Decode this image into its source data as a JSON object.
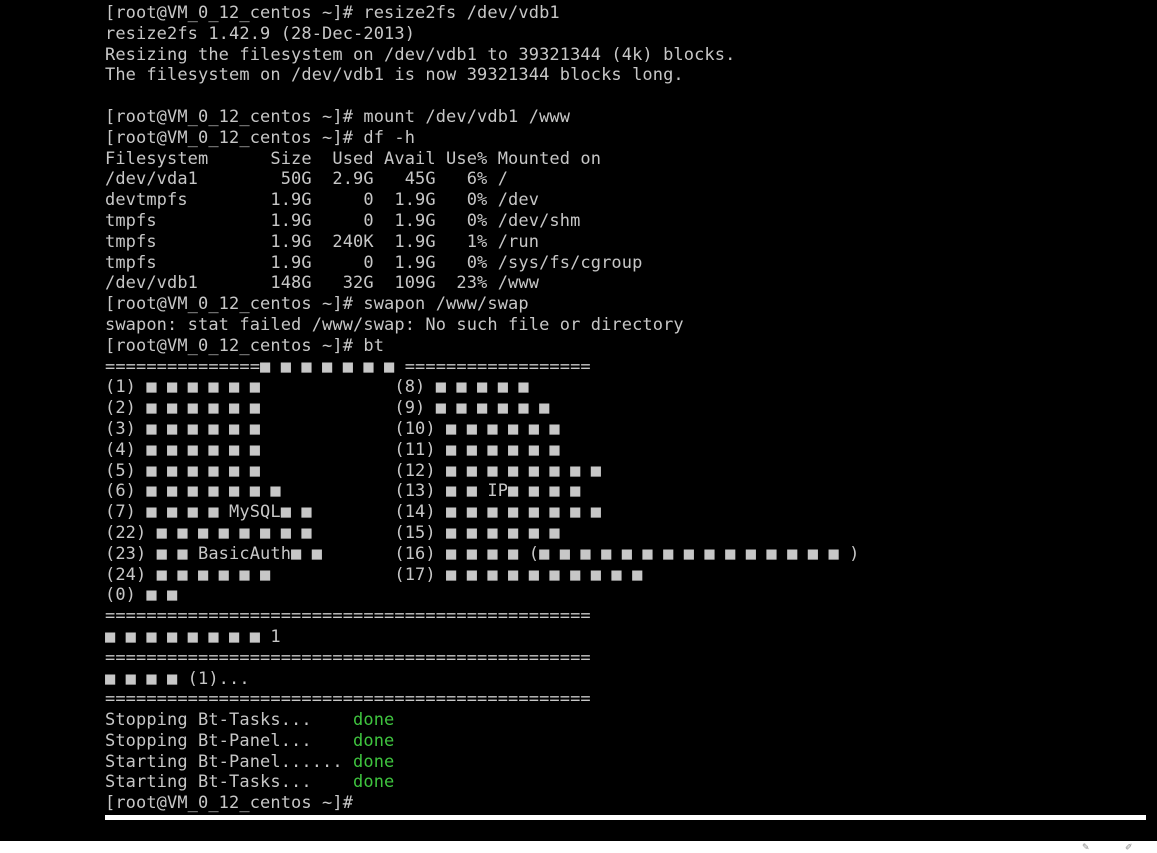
{
  "terminal": {
    "lines": [
      "[root@VM_0_12_centos ~]# resize2fs /dev/vdb1",
      "resize2fs 1.42.9 (28-Dec-2013)",
      "Resizing the filesystem on /dev/vdb1 to 39321344 (4k) blocks.",
      "The filesystem on /dev/vdb1 is now 39321344 blocks long.",
      "",
      "[root@VM_0_12_centos ~]# mount /dev/vdb1 /www",
      "[root@VM_0_12_centos ~]# df -h",
      "Filesystem      Size  Used Avail Use% Mounted on",
      "/dev/vda1        50G  2.9G   45G   6% /",
      "devtmpfs        1.9G     0  1.9G   0% /dev",
      "tmpfs           1.9G     0  1.9G   0% /dev/shm",
      "tmpfs           1.9G  240K  1.9G   1% /run",
      "tmpfs           1.9G     0  1.9G   0% /sys/fs/cgroup",
      "/dev/vdb1       148G   32G  109G  23% /www",
      "[root@VM_0_12_centos ~]# swapon /www/swap",
      "swapon: stat failed /www/swap: No such file or directory",
      "[root@VM_0_12_centos ~]# bt",
      "===============■ ■ ■ ■ ■ ■ ■ ==================",
      "(1) ■ ■ ■ ■ ■ ■             (8) ■ ■ ■ ■ ■",
      "(2) ■ ■ ■ ■ ■ ■             (9) ■ ■ ■ ■ ■ ■",
      "(3) ■ ■ ■ ■ ■ ■             (10) ■ ■ ■ ■ ■ ■",
      "(4) ■ ■ ■ ■ ■ ■             (11) ■ ■ ■ ■ ■ ■",
      "(5) ■ ■ ■ ■ ■ ■             (12) ■ ■ ■ ■ ■ ■ ■ ■",
      "(6) ■ ■ ■ ■ ■ ■ ■           (13) ■ ■ IP■ ■ ■ ■",
      "(7) ■ ■ ■ ■ MySQL■ ■        (14) ■ ■ ■ ■ ■ ■ ■ ■",
      "(22) ■ ■ ■ ■ ■ ■ ■ ■        (15) ■ ■ ■ ■ ■ ■",
      "(23) ■ ■ BasicAuth■ ■       (16) ■ ■ ■ ■ (■ ■ ■ ■ ■ ■ ■ ■ ■ ■ ■ ■ ■ ■ ■ )",
      "(24) ■ ■ ■ ■ ■ ■            (17) ■ ■ ■ ■ ■ ■ ■ ■ ■ ■",
      "(0) ■ ■",
      "===============================================",
      "■ ■ ■ ■ ■ ■ ■ ■ 1",
      "===============================================",
      "■ ■ ■ ■ (1)...",
      "==============================================="
    ],
    "services": [
      {
        "text": "Stopping Bt-Tasks...    ",
        "status": "done"
      },
      {
        "text": "Stopping Bt-Panel...    ",
        "status": "done"
      },
      {
        "text": "Starting Bt-Panel...... ",
        "status": "done"
      },
      {
        "text": "Starting Bt-Tasks...    ",
        "status": "done"
      }
    ],
    "prompt": "[root@VM_0_12_centos ~]#"
  },
  "colors": {
    "background": "#000000",
    "text": "#c7c7c7",
    "status_done": "#3fc53f"
  }
}
